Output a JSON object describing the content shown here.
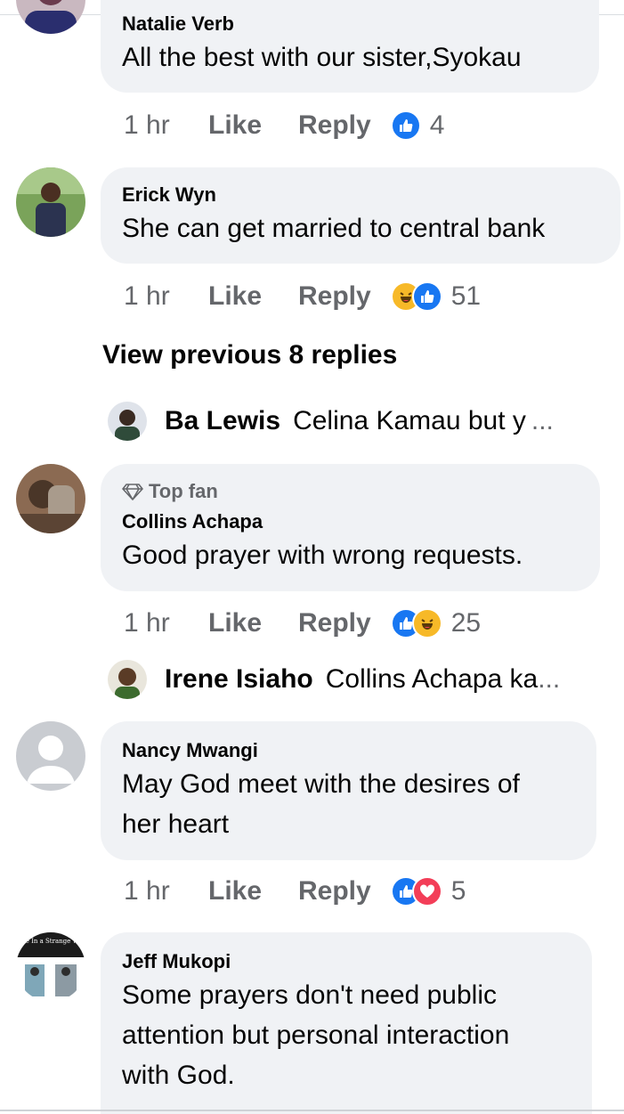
{
  "comments": [
    {
      "name": "Natalie Verb",
      "text": "All the best with our sister,Syokau",
      "time": "1 hr",
      "like": "Like",
      "reply": "Reply",
      "reactions": [
        "like-icon"
      ],
      "count": "4"
    },
    {
      "name": "Erick Wyn",
      "text": "She can get married to central bank",
      "time": "1 hr",
      "like": "Like",
      "reply": "Reply",
      "reactions": [
        "haha-icon",
        "like-icon"
      ],
      "count": "51",
      "view_previous": "View previous 8 replies",
      "reply_preview": {
        "name": "Ba Lewis",
        "text": "Celina Kamau but y",
        "ellipsis": "..."
      }
    },
    {
      "badge": "Top fan",
      "badge_icon": "diamond-icon",
      "name": "Collins Achapa",
      "text": "Good prayer with wrong requests.",
      "time": "1 hr",
      "like": "Like",
      "reply": "Reply",
      "reactions": [
        "like-icon",
        "haha-icon"
      ],
      "count": "25",
      "reply_preview": {
        "name": "Irene Isiaho",
        "text": "Collins Achapa ka",
        "ellipsis": "..."
      }
    },
    {
      "name": "Nancy Mwangi",
      "text_line1": "May God meet with the desires of",
      "text_line2": "her heart",
      "time": "1 hr",
      "like": "Like",
      "reply": "Reply",
      "reactions": [
        "like-icon",
        "love-icon"
      ],
      "count": "5"
    },
    {
      "name": "Jeff Mukopi",
      "avatar_caption": "e Live In a Strange World",
      "text_line1": "Some prayers don't need public",
      "text_line2": "attention but personal interaction",
      "text_line3": "with God."
    }
  ],
  "colors": {
    "bubble": "#f0f2f5",
    "meta_text": "#65676b",
    "like_blue": "#1877f2",
    "love_red": "#f33e58",
    "haha_yellow": "#f7b928"
  }
}
